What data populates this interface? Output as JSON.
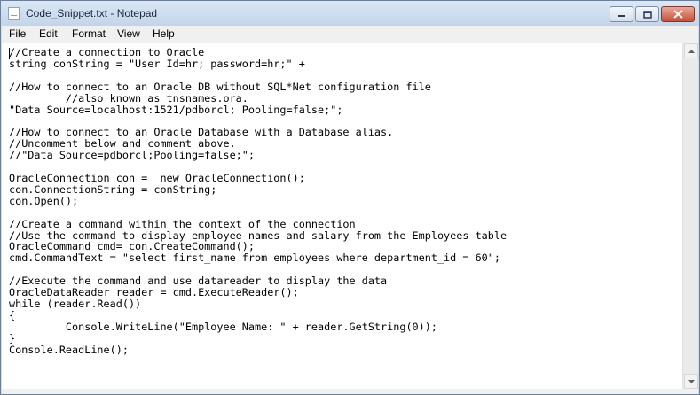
{
  "window": {
    "title": "Code_Snippet.txt - Notepad"
  },
  "menu": {
    "file": "File",
    "edit": "Edit",
    "format": "Format",
    "view": "View",
    "help": "Help"
  },
  "editor": {
    "content": "//Create a connection to Oracle\nstring conString = \"User Id=hr; password=hr;\" +\n\n//How to connect to an Oracle DB without SQL*Net configuration file\n         //also known as tnsnames.ora.\n\"Data Source=localhost:1521/pdborcl; Pooling=false;\";\n\n//How to connect to an Oracle Database with a Database alias.\n//Uncomment below and comment above.\n//\"Data Source=pdborcl;Pooling=false;\";\n\nOracleConnection con =  new OracleConnection();\ncon.ConnectionString = conString;\ncon.Open();\n\n//Create a command within the context of the connection\n//Use the command to display employee names and salary from the Employees table\nOracleCommand cmd= con.CreateCommand();\ncmd.CommandText = \"select first_name from employees where department_id = 60\";\n\n//Execute the command and use datareader to display the data\nOracleDataReader reader = cmd.ExecuteReader();\nwhile (reader.Read())\n{\n         Console.WriteLine(\"Employee Name: \" + reader.GetString(0));\n}\nConsole.ReadLine();"
  },
  "icons": {
    "app": "notepad-icon",
    "minimize": "minimize-icon",
    "maximize": "maximize-icon",
    "close": "close-icon",
    "scroll_up": "scroll-up-arrow-icon",
    "scroll_down": "scroll-down-arrow-icon"
  }
}
